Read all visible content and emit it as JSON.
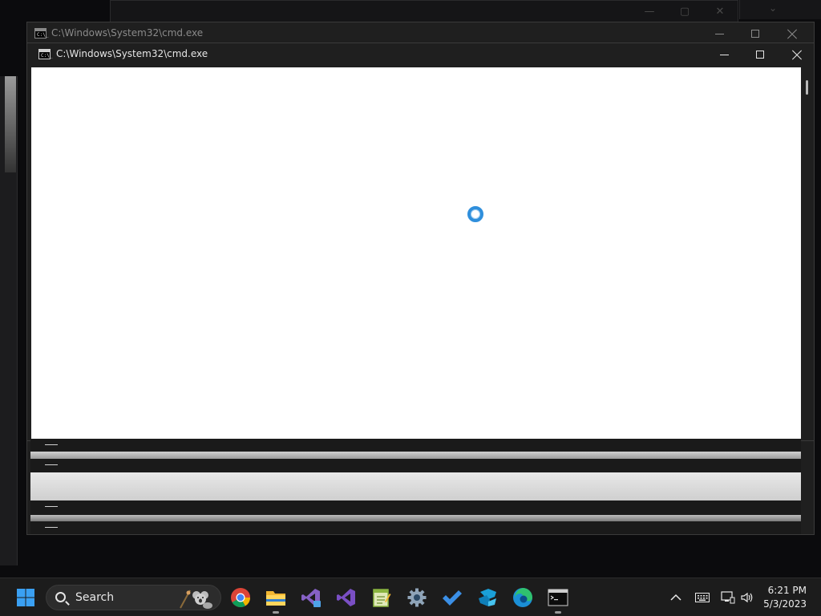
{
  "windows": {
    "background": {
      "title": "C:\\Windows\\System32\\cmd.exe",
      "icon": "cmd-icon",
      "prompt_glyph": "C:\\_"
    },
    "foreground": {
      "title": "C:\\Windows\\System32\\cmd.exe",
      "icon": "cmd-icon",
      "prompt_glyph": "C:\\_",
      "state": "loading"
    }
  },
  "colors": {
    "accent": "#2f8fdc",
    "taskbar": "#1c1c1c",
    "titlebar": "#1f1f1f",
    "client_bg": "#ffffff"
  },
  "taskbar": {
    "start_icon": "windows-start-icon",
    "search": {
      "label": "Search",
      "highlight_icon": "koala-icon"
    },
    "pinned": [
      {
        "name": "chrome",
        "icon": "chrome-icon",
        "running": false
      },
      {
        "name": "file-explorer",
        "icon": "folder-icon",
        "running": true
      },
      {
        "name": "visual-studio-preview",
        "icon": "visual-studio-preview-icon",
        "running": false
      },
      {
        "name": "visual-studio",
        "icon": "visual-studio-icon",
        "running": false
      },
      {
        "name": "notepad-plus",
        "icon": "notepad-icon",
        "running": false
      },
      {
        "name": "settings",
        "icon": "gear-icon",
        "running": false
      },
      {
        "name": "todo",
        "icon": "checkmark-icon",
        "running": false
      },
      {
        "name": "azure-data-studio",
        "icon": "azure-data-studio-icon",
        "running": false
      },
      {
        "name": "edge",
        "icon": "edge-icon",
        "running": false
      },
      {
        "name": "command-prompt",
        "icon": "cmd-icon",
        "running": true
      }
    ],
    "tray": {
      "overflow_icon": "chevron-up-icon",
      "keyboard_icon": "keyboard-icon",
      "network_icon": "network-icon",
      "volume_icon": "speaker-icon",
      "time": "6:21 PM",
      "date": "5/3/2023"
    }
  }
}
